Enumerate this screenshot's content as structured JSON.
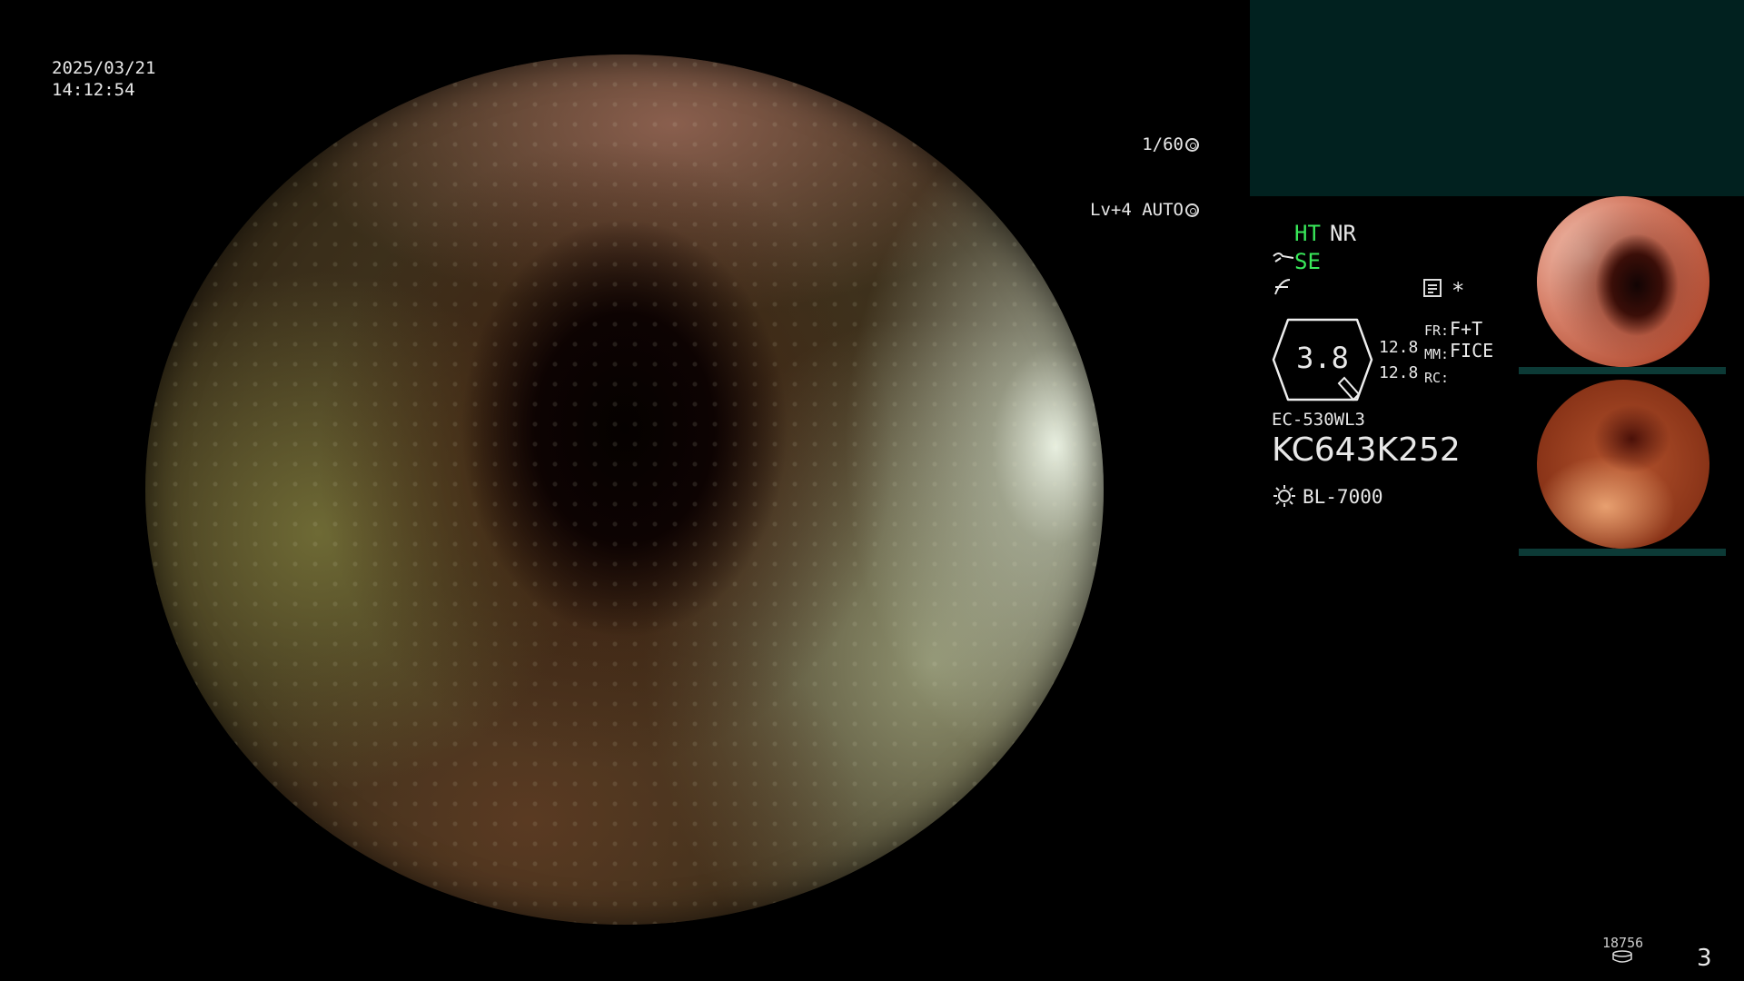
{
  "overlay": {
    "date": "2025/03/21",
    "time": "14:12:54",
    "shutter": "1/60",
    "level": "Lv+4 AUTO"
  },
  "hud": {
    "ht": "HT",
    "nr": "NR",
    "se": "SE",
    "gauge_value": "3.8",
    "val_a": "12.8",
    "val_b": "12.8",
    "fr_label": "FR:",
    "fr_value": "F+T",
    "mm_label": "MM:",
    "mm_value": "FICE",
    "rc_label": "RC:",
    "asterisk": "*",
    "scope_model": "EC-530WL3",
    "serial": "KC643K252",
    "light_source": "BL-7000"
  },
  "footer": {
    "counter": "18756",
    "page": "3"
  },
  "colors": {
    "accent_green": "#39e85a",
    "panel_teal": "#01211f"
  }
}
